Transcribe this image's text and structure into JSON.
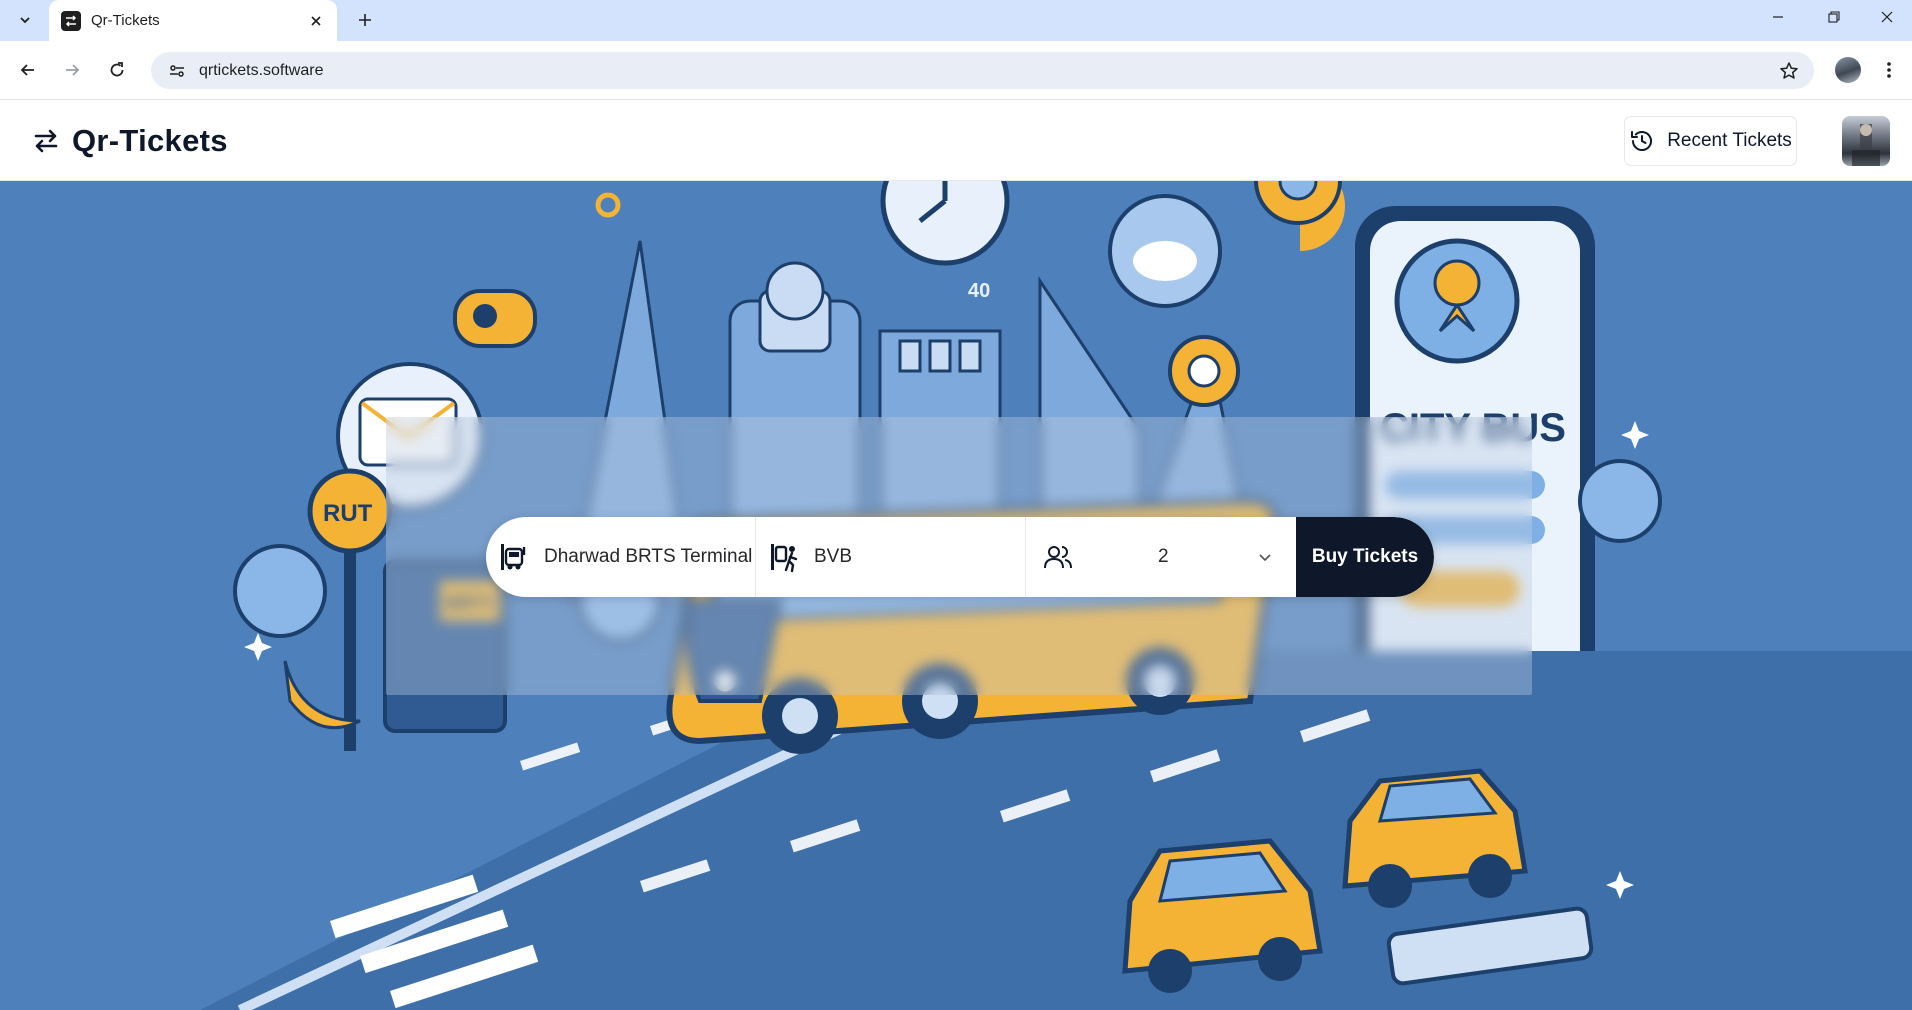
{
  "browser": {
    "tab_title": "Qr-Tickets",
    "url": "qrtickets.software"
  },
  "header": {
    "brand": "Qr-Tickets",
    "recent_tickets_label": "Recent Tickets"
  },
  "search": {
    "from_value": "Dharwad BRTS Terminal",
    "to_value": "BVB",
    "passengers_value": "2",
    "buy_label": "Buy Tickets"
  },
  "illustration": {
    "bus_stop_sign": "RUT",
    "kiosk_sign": "BRTY",
    "billboard_text": "CITY BUS",
    "clock_marker": "40"
  },
  "colors": {
    "brand_dark": "#0f172a",
    "hero_blue": "#4a7db8",
    "bus_yellow": "#f5b335",
    "chrome_tab": "#d3e3fd"
  }
}
